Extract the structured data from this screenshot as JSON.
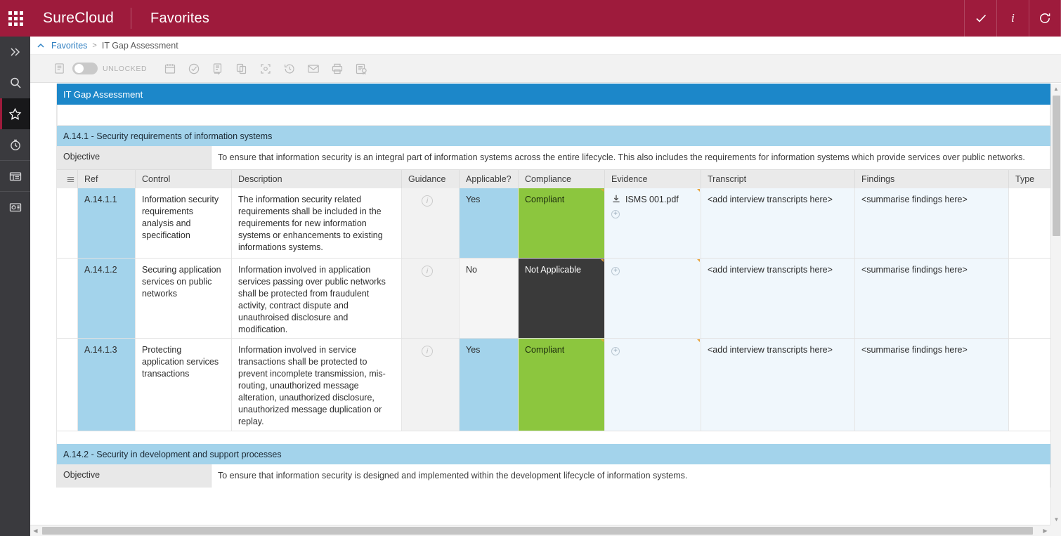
{
  "topbar": {
    "app_launcher_icon": "grid-dots-icon",
    "brand": "SureCloud",
    "section": "Favorites",
    "actions": [
      {
        "name": "approve-check-icon",
        "glyph": "✓"
      },
      {
        "name": "info-icon",
        "glyph": "i"
      },
      {
        "name": "refresh-icon",
        "glyph": "⟳"
      }
    ],
    "accent_color": "#9E1B3C"
  },
  "rail": {
    "items": [
      {
        "name": "expand-chevrons-icon",
        "label": "Expand"
      },
      {
        "name": "search-icon",
        "label": "Search"
      },
      {
        "name": "favorites-star-icon",
        "label": "Favorites",
        "active": true
      },
      {
        "name": "recent-timer-icon",
        "label": "Recent"
      },
      {
        "name": "dashboards-icon",
        "label": "Dashboards"
      },
      {
        "name": "reports-icon",
        "label": "Reports"
      }
    ]
  },
  "breadcrumb": {
    "collapse_icon": "chevron-up-icon",
    "root": "Favorites",
    "separator": ">",
    "current": "IT Gap Assessment"
  },
  "toolbar": {
    "form_icon": "form-icon",
    "lock_state": "UNLOCKED",
    "icons": [
      {
        "name": "calendar-icon"
      },
      {
        "name": "check-circle-icon"
      },
      {
        "name": "workflow-icon"
      },
      {
        "name": "copy-icon"
      },
      {
        "name": "focus-target-icon"
      },
      {
        "name": "history-clock-icon"
      },
      {
        "name": "email-icon"
      },
      {
        "name": "print-icon"
      },
      {
        "name": "certificate-icon"
      }
    ]
  },
  "sheet": {
    "title": "IT Gap Assessment",
    "title_bg": "#1C87C9",
    "sections": [
      {
        "heading": "A.14.1 - Security requirements of information systems",
        "objective_label": "Objective",
        "objective_text": "To ensure that information security is an integral part of information systems across the entire lifecycle. This also includes the requirements for information systems which provide services over public networks.",
        "columns": [
          "Ref",
          "Control",
          "Description",
          "Guidance",
          "Applicable?",
          "Compliance",
          "Evidence",
          "Transcript",
          "Findings",
          "Type"
        ],
        "rows": [
          {
            "ref": "A.14.1.1",
            "control": "Information security requirements analysis and specification",
            "description": "The information security related requirements shall be included in the requirements for new information systems or enhancements to existing informations systems.",
            "guidance": "info-icon",
            "applicable": "Yes",
            "compliance": "Compliant",
            "compliance_color": "#8CC63E",
            "evidence": "ISMS 001.pdf",
            "evidence_icon": "download-icon",
            "add_icon": "plus-circle-icon",
            "transcript": "<add interview transcripts here>",
            "findings": "<summarise findings here>",
            "type": ""
          },
          {
            "ref": "A.14.1.2",
            "control": "Securing application services on public networks",
            "description": "Information involved in application services passing over public networks shall be protected from fraudulent activity, contract dispute and unauthroised disclosure and modification.",
            "guidance": "info-icon",
            "applicable": "No",
            "compliance": "Not Applicable",
            "compliance_color": "#3A3A3A",
            "evidence": "",
            "add_icon": "plus-circle-icon",
            "transcript": "<add interview transcripts here>",
            "findings": "<summarise findings here>",
            "type": ""
          },
          {
            "ref": "A.14.1.3",
            "control": "Protecting application services transactions",
            "description": "Information involved in service transactions shall be protected to prevent incomplete transmission, mis-routing, unauthorized message alteration, unauthorized disclosure, unauthorized message duplication or replay.",
            "guidance": "info-icon",
            "applicable": "Yes",
            "compliance": "Compliant",
            "compliance_color": "#8CC63E",
            "evidence": "",
            "add_icon": "plus-circle-icon",
            "transcript": "<add interview transcripts here>",
            "findings": "<summarise findings here>",
            "type": ""
          }
        ]
      },
      {
        "heading": "A.14.2 - Security in development and support processes",
        "objective_label": "Objective",
        "objective_text": "To ensure that information security is designed and implemented within the development lifecycle of information systems."
      }
    ]
  }
}
